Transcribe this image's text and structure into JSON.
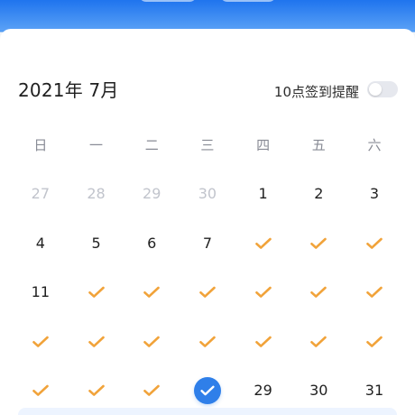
{
  "header": {
    "background": "#2f82f0"
  },
  "calendar": {
    "title": "2021年 7月",
    "reminder_label": "10点签到提醒",
    "toggle_on": false,
    "weekdays": [
      "日",
      "一",
      "二",
      "三",
      "四",
      "五",
      "六"
    ],
    "weeks": [
      [
        {
          "type": "date",
          "label": "27",
          "muted": true
        },
        {
          "type": "date",
          "label": "28",
          "muted": true
        },
        {
          "type": "date",
          "label": "29",
          "muted": true
        },
        {
          "type": "date",
          "label": "30",
          "muted": true
        },
        {
          "type": "date",
          "label": "1",
          "muted": false
        },
        {
          "type": "date",
          "label": "2",
          "muted": false
        },
        {
          "type": "date",
          "label": "3",
          "muted": false
        }
      ],
      [
        {
          "type": "date",
          "label": "4",
          "muted": false
        },
        {
          "type": "date",
          "label": "5",
          "muted": false
        },
        {
          "type": "date",
          "label": "6",
          "muted": false
        },
        {
          "type": "date",
          "label": "7",
          "muted": false
        },
        {
          "type": "check"
        },
        {
          "type": "check"
        },
        {
          "type": "check"
        }
      ],
      [
        {
          "type": "date",
          "label": "11",
          "muted": false
        },
        {
          "type": "check"
        },
        {
          "type": "check"
        },
        {
          "type": "check"
        },
        {
          "type": "check"
        },
        {
          "type": "check"
        },
        {
          "type": "check"
        }
      ],
      [
        {
          "type": "check"
        },
        {
          "type": "check"
        },
        {
          "type": "check"
        },
        {
          "type": "check"
        },
        {
          "type": "check"
        },
        {
          "type": "check"
        },
        {
          "type": "check"
        }
      ],
      [
        {
          "type": "check"
        },
        {
          "type": "check"
        },
        {
          "type": "check"
        },
        {
          "type": "selected"
        },
        {
          "type": "date",
          "label": "29",
          "muted": false
        },
        {
          "type": "date",
          "label": "30",
          "muted": false
        },
        {
          "type": "date",
          "label": "31",
          "muted": false
        }
      ]
    ]
  },
  "colors": {
    "check": "#f1a33a",
    "selected": "#2f7fe9",
    "muted_text": "#c1c4cc",
    "weekday_text": "#888b95"
  },
  "icons": {
    "check": "check-icon",
    "selected": "selected-check-icon"
  }
}
